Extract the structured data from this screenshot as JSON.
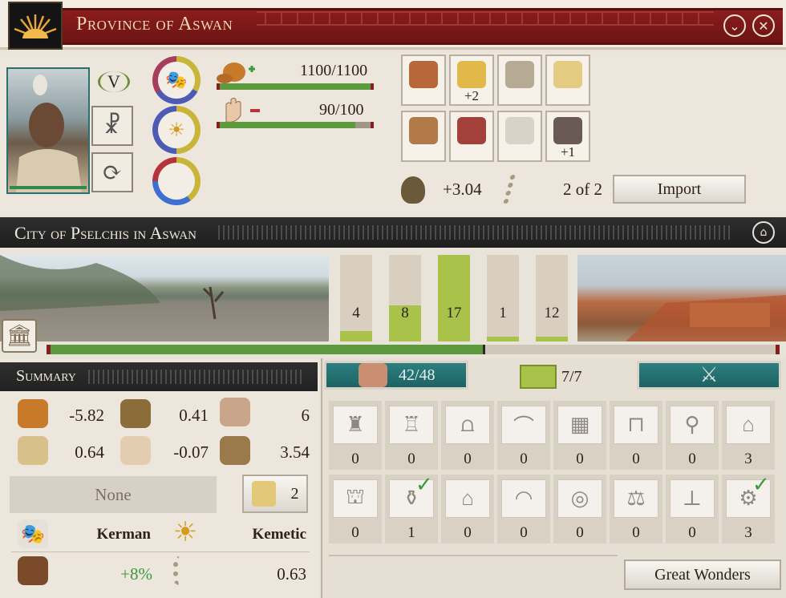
{
  "province": {
    "title": "Province of Aswan",
    "rank": "V"
  },
  "stats": [
    {
      "value": "1100/1100",
      "fill": 1.0
    },
    {
      "value": "90/100",
      "fill": 0.9
    }
  ],
  "resources": [
    {
      "icon": "amphora-icon",
      "bonus": ""
    },
    {
      "icon": "grain-icon",
      "bonus": "+2"
    },
    {
      "icon": "stone-blocks-icon",
      "bonus": ""
    },
    {
      "icon": "papyrus-icon",
      "bonus": ""
    },
    {
      "icon": "deer-icon",
      "bonus": ""
    },
    {
      "icon": "spices-icon",
      "bonus": ""
    },
    {
      "icon": "cattle-icon",
      "bonus": ""
    },
    {
      "icon": "iron-icon",
      "bonus": "+1"
    }
  ],
  "trade": {
    "income": "+3.04",
    "routes": "2 of 2",
    "import_label": "Import"
  },
  "city": {
    "title": "City of Pselchis in Aswan"
  },
  "pops": [
    {
      "value": "4",
      "level": 0.12
    },
    {
      "value": "8",
      "level": 0.42
    },
    {
      "value": "17",
      "level": 1.0
    },
    {
      "value": "1",
      "level": 0.06
    },
    {
      "value": "12",
      "level": 0.06
    }
  ],
  "city_progress": 0.6,
  "summary": {
    "title": "Summary",
    "rows": [
      [
        "-5.82",
        "0.41",
        "6"
      ],
      [
        "0.64",
        "-0.07",
        "3.54"
      ]
    ],
    "governor": "None",
    "scroll_count": "2",
    "culture": "Kerman",
    "religion": "Kemetic",
    "bonus": "+8%",
    "road": "0.63"
  },
  "tabs": {
    "pop": "42/48",
    "slots": "7/7"
  },
  "buildings_row1": [
    "0",
    "0",
    "0",
    "0",
    "0",
    "0",
    "0",
    "3"
  ],
  "buildings_row2": [
    "0",
    "1",
    "0",
    "0",
    "0",
    "0",
    "0",
    "3"
  ],
  "great_wonders": "Great Wonders",
  "colors": {
    "accent": "#8a1c1c",
    "teal": "#2c7f80",
    "green": "#5c9a3d"
  }
}
